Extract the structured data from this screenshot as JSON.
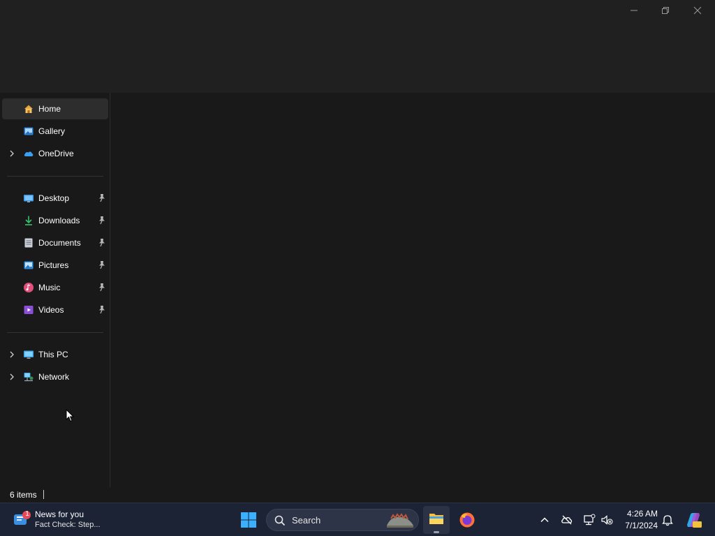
{
  "window": {
    "controls": [
      "minimize",
      "restore",
      "close"
    ]
  },
  "nav": {
    "top_items": [
      {
        "label": "Home",
        "icon": "home-icon",
        "selected": true,
        "expandable": false
      },
      {
        "label": "Gallery",
        "icon": "gallery-icon",
        "selected": false,
        "expandable": false
      },
      {
        "label": "OneDrive",
        "icon": "onedrive-icon",
        "selected": false,
        "expandable": true
      }
    ],
    "quick_access": [
      {
        "label": "Desktop",
        "icon": "desktop-icon",
        "pinned": true
      },
      {
        "label": "Downloads",
        "icon": "downloads-icon",
        "pinned": true
      },
      {
        "label": "Documents",
        "icon": "documents-icon",
        "pinned": true
      },
      {
        "label": "Pictures",
        "icon": "pictures-icon",
        "pinned": true
      },
      {
        "label": "Music",
        "icon": "music-icon",
        "pinned": true
      },
      {
        "label": "Videos",
        "icon": "videos-icon",
        "pinned": true
      }
    ],
    "locations": [
      {
        "label": "This PC",
        "icon": "this-pc-icon",
        "expandable": true
      },
      {
        "label": "Network",
        "icon": "network-icon",
        "expandable": true
      }
    ]
  },
  "status": {
    "item_count": "6 items"
  },
  "taskbar": {
    "news": {
      "title": "News for you",
      "subtitle": "Fact Check: Step...",
      "badge": "1"
    },
    "search": {
      "label": "Search"
    },
    "pinned_apps": [
      "start-icon",
      "file-explorer-icon",
      "firefox-icon"
    ],
    "tray": {
      "time": "4:26 AM",
      "date": "7/1/2024"
    }
  },
  "colors": {
    "background": "#191919",
    "titlebar": "#202020",
    "selected": "#2d2d2d",
    "taskbar": "#1c2335",
    "accent": "#60cdff"
  }
}
